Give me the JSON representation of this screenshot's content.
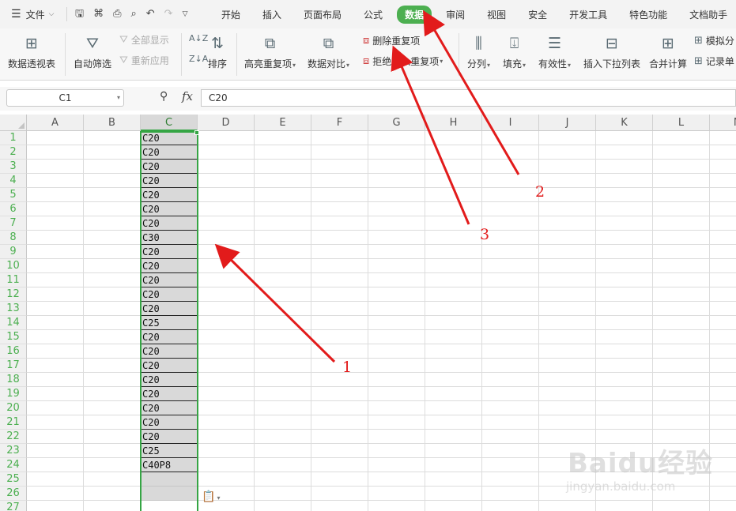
{
  "menubar": {
    "file_label": "文件",
    "tabs": [
      "开始",
      "插入",
      "页面布局",
      "公式",
      "数据",
      "审阅",
      "视图",
      "安全",
      "开发工具",
      "特色功能",
      "文档助手"
    ],
    "active_tab": "数据"
  },
  "ribbon": {
    "pivot": "数据透视表",
    "autofilter": "自动筛选",
    "show_all": "全部显示",
    "reapply": "重新应用",
    "sort": "排序",
    "highlight_dup": "高亮重复项",
    "data_compare": "数据对比",
    "remove_dup": "删除重复项",
    "reject_dup": "拒绝录入重复项",
    "split": "分列",
    "fill": "填充",
    "validity": "有效性",
    "insert_dropdown": "插入下拉列表",
    "consolidate": "合并计算",
    "simulate": "模拟分",
    "record": "记录单"
  },
  "formula_bar": {
    "cell_ref": "C1",
    "fx": "fx",
    "value": "C20"
  },
  "columns": [
    "A",
    "B",
    "C",
    "D",
    "E",
    "F",
    "G",
    "H",
    "I",
    "J",
    "K",
    "L",
    "M"
  ],
  "selected_column": "C",
  "rows": [
    "1",
    "2",
    "3",
    "4",
    "5",
    "6",
    "7",
    "8",
    "9",
    "10",
    "11",
    "12",
    "13",
    "14",
    "15",
    "16",
    "17",
    "18",
    "19",
    "20",
    "21",
    "22",
    "23",
    "24",
    "25",
    "26",
    "27"
  ],
  "column_c_values": [
    "C20",
    "C20",
    "C20",
    "C20",
    "C20",
    "C20",
    "C20",
    "C30",
    "C20",
    "C20",
    "C20",
    "C20",
    "C20",
    "C25",
    "C20",
    "C20",
    "C20",
    "C20",
    "C20",
    "C20",
    "C20",
    "C20",
    "C25",
    "C40P8",
    "",
    ""
  ],
  "annotations": [
    "1",
    "2",
    "3"
  ],
  "watermark": {
    "logo": "Baidu经验",
    "url": "jingyan.baidu.com"
  },
  "colors": {
    "accent": "#4caf50",
    "annotation": "#e21b1b",
    "selection": "#35a544"
  }
}
